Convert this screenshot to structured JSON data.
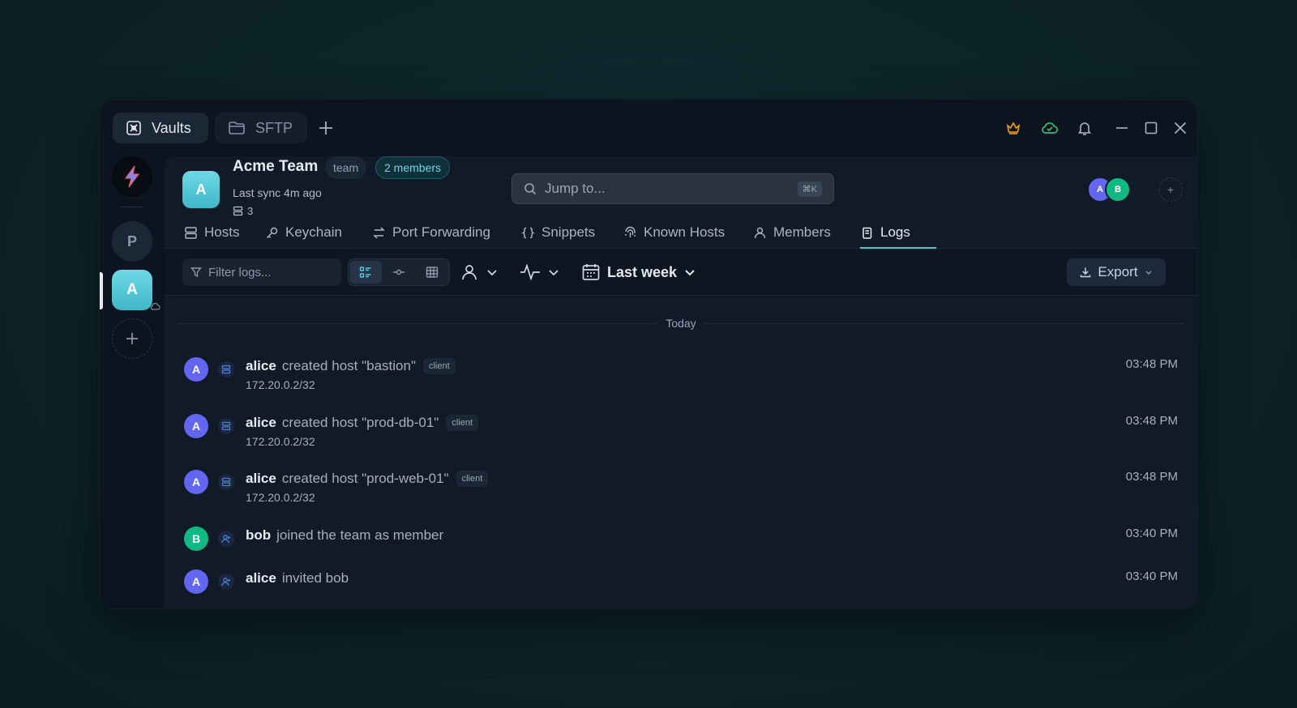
{
  "titlebar": {
    "tabs": [
      {
        "label": "Vaults",
        "icon": "vault-icon",
        "active": true
      },
      {
        "label": "SFTP",
        "icon": "folder-icon",
        "active": false
      }
    ],
    "icons": [
      "crown-icon",
      "cloud-check-icon",
      "bell-icon",
      "minimize-icon",
      "maximize-icon",
      "close-icon"
    ]
  },
  "rail": {
    "items": [
      {
        "letter": "P"
      },
      {
        "letter": "A",
        "active": true
      }
    ]
  },
  "team": {
    "avatar_letter": "A",
    "name": "Acme Team",
    "type_chip": "team",
    "members_chip": "2 members",
    "last_sync": "Last sync 4m ago",
    "host_count": "3"
  },
  "search": {
    "placeholder": "Jump to...",
    "shortcut": "⌘K"
  },
  "member_avatars": [
    {
      "letter": "A",
      "color": "#6366f1"
    },
    {
      "letter": "B",
      "color": "#10b981"
    }
  ],
  "nav": {
    "tabs": [
      {
        "label": "Hosts",
        "icon": "server-icon"
      },
      {
        "label": "Keychain",
        "icon": "key-icon"
      },
      {
        "label": "Port Forwarding",
        "icon": "arrows-icon"
      },
      {
        "label": "Snippets",
        "icon": "braces-icon"
      },
      {
        "label": "Known Hosts",
        "icon": "fingerprint-icon"
      },
      {
        "label": "Members",
        "icon": "user-icon"
      },
      {
        "label": "Logs",
        "icon": "logs-icon",
        "active": true
      }
    ]
  },
  "toolbar": {
    "filter_placeholder": "Filter logs...",
    "view_modes": [
      "list",
      "timeline",
      "table"
    ],
    "date_range": "Last week",
    "export_label": "Export"
  },
  "logs": {
    "day_label": "Today",
    "entries": [
      {
        "avatar": "A",
        "avatar_color": "#6366f1",
        "icon": "server-icon",
        "actor": "alice",
        "action": "created host \"bastion\"",
        "badge": "client",
        "detail": "172.20.0.2/32",
        "time": "03:48 PM"
      },
      {
        "avatar": "A",
        "avatar_color": "#6366f1",
        "icon": "server-icon",
        "actor": "alice",
        "action": "created host \"prod-db-01\"",
        "badge": "client",
        "detail": "172.20.0.2/32",
        "time": "03:48 PM"
      },
      {
        "avatar": "A",
        "avatar_color": "#6366f1",
        "icon": "server-icon",
        "actor": "alice",
        "action": "created host \"prod-web-01\"",
        "badge": "client",
        "detail": "172.20.0.2/32",
        "time": "03:48 PM"
      },
      {
        "avatar": "B",
        "avatar_color": "#10b981",
        "icon": "user-plus-icon",
        "actor": "bob",
        "action": "joined the team as member",
        "badge": "",
        "detail": "",
        "time": "03:40 PM"
      },
      {
        "avatar": "A",
        "avatar_color": "#6366f1",
        "icon": "user-plus-icon",
        "actor": "alice",
        "action": "invited bob",
        "badge": "",
        "detail": "",
        "time": "03:40 PM"
      }
    ]
  },
  "colors": {
    "accent": "#4fc6d8",
    "background": "#0c1420",
    "panel": "#111a27"
  }
}
